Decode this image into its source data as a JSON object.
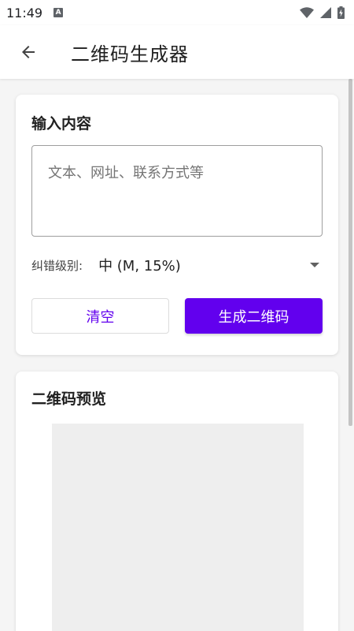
{
  "status_bar": {
    "time": "11:49",
    "notification_icon": "A"
  },
  "app_bar": {
    "title": "二维码生成器",
    "back_icon": "arrow-back-icon"
  },
  "input_card": {
    "title": "输入内容",
    "placeholder": "文本、网址、联系方式等",
    "ecc_label": "纠错级别:",
    "ecc_selected": "中 (M, 15%)",
    "clear_label": "清空",
    "generate_label": "生成二维码"
  },
  "preview_card": {
    "title": "二维码预览"
  },
  "colors": {
    "accent": "#6200ee",
    "background": "#f5f5f5",
    "card": "#ffffff",
    "placeholder_bg": "#eeeeee"
  }
}
